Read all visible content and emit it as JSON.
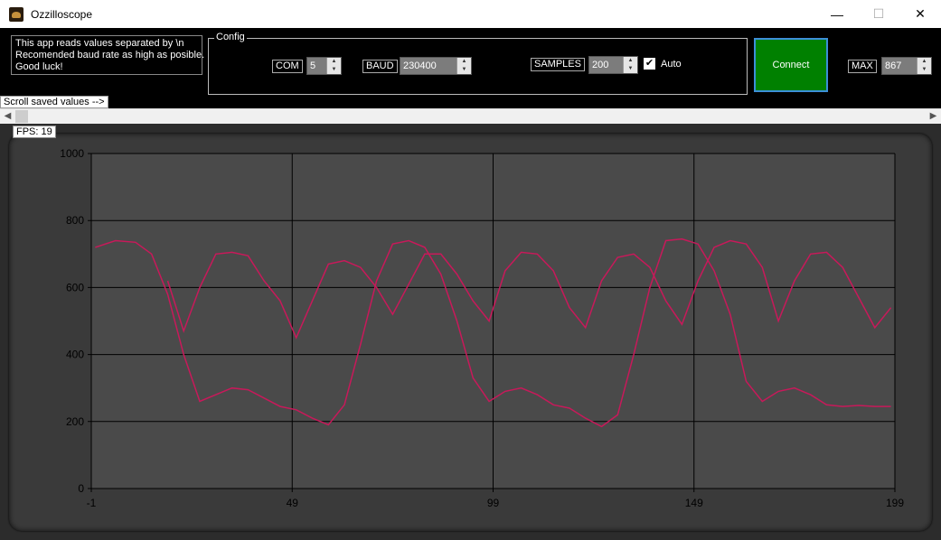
{
  "window": {
    "title": "Ozzilloscope",
    "minimize": "—",
    "maximize": "☐",
    "close": "✕"
  },
  "info_text": "This app reads values separated by \\n\nRecomended baud rate as high as posible.\nGood luck!",
  "config": {
    "legend": "Config",
    "com_label": "COM",
    "com_value": "5",
    "baud_label": "BAUD",
    "baud_value": "230400",
    "samples_label": "SAMPLES",
    "samples_value": "200",
    "auto_label": "Auto",
    "auto_checked": true
  },
  "connect_label": "Connect",
  "max_label": "MAX",
  "max_value": "867",
  "scroll_label": "Scroll saved values -->",
  "fps_label": "FPS: 19",
  "colors": {
    "series": "#c8195a",
    "plot_bg": "#4a4a4a",
    "connect": "#008000"
  },
  "chart_data": {
    "type": "line",
    "ylim": [
      0,
      1000
    ],
    "y_ticks": [
      "0",
      "200",
      "400",
      "600",
      "800",
      "1000"
    ],
    "x_ticks": [
      "-1",
      "49",
      "99",
      "149",
      "199"
    ],
    "xlim": [
      -1,
      199
    ],
    "grid": true,
    "series": [
      {
        "x": [
          0,
          5,
          10,
          14,
          18,
          22,
          26,
          30,
          34,
          38,
          42,
          46,
          50,
          54,
          58,
          62,
          66,
          70,
          74,
          78,
          82,
          86,
          90,
          94,
          98,
          102,
          106,
          110,
          114,
          118,
          122,
          126,
          130,
          134,
          138,
          142,
          146,
          150,
          154,
          158,
          162,
          166,
          170,
          174,
          178,
          182,
          186,
          190,
          194,
          198
        ],
        "values": [
          720,
          740,
          735,
          700,
          580,
          400,
          260,
          280,
          300,
          295,
          270,
          245,
          235,
          210,
          190,
          250,
          430,
          620,
          730,
          740,
          720,
          640,
          500,
          330,
          260,
          290,
          300,
          280,
          250,
          240,
          210,
          185,
          220,
          400,
          600,
          740,
          745,
          730,
          650,
          520,
          320,
          260,
          290,
          300,
          280,
          250,
          245,
          248,
          245,
          245
        ]
      },
      {
        "x": [
          18,
          22,
          26,
          30,
          34,
          38,
          42,
          46,
          50,
          54,
          58,
          62,
          66,
          70,
          74,
          78,
          82,
          86,
          90,
          94,
          98,
          102,
          106,
          110,
          114,
          118,
          122,
          126,
          130,
          134,
          138,
          142,
          146,
          150,
          154,
          158,
          162,
          166,
          170,
          174,
          178,
          182,
          186,
          190,
          194,
          198
        ],
        "values": [
          620,
          470,
          600,
          700,
          705,
          695,
          620,
          560,
          450,
          560,
          670,
          680,
          660,
          600,
          520,
          610,
          700,
          700,
          640,
          560,
          500,
          650,
          705,
          700,
          650,
          540,
          480,
          620,
          690,
          700,
          660,
          560,
          490,
          620,
          720,
          740,
          730,
          660,
          500,
          620,
          700,
          705,
          660,
          570,
          480,
          540
        ]
      }
    ]
  }
}
